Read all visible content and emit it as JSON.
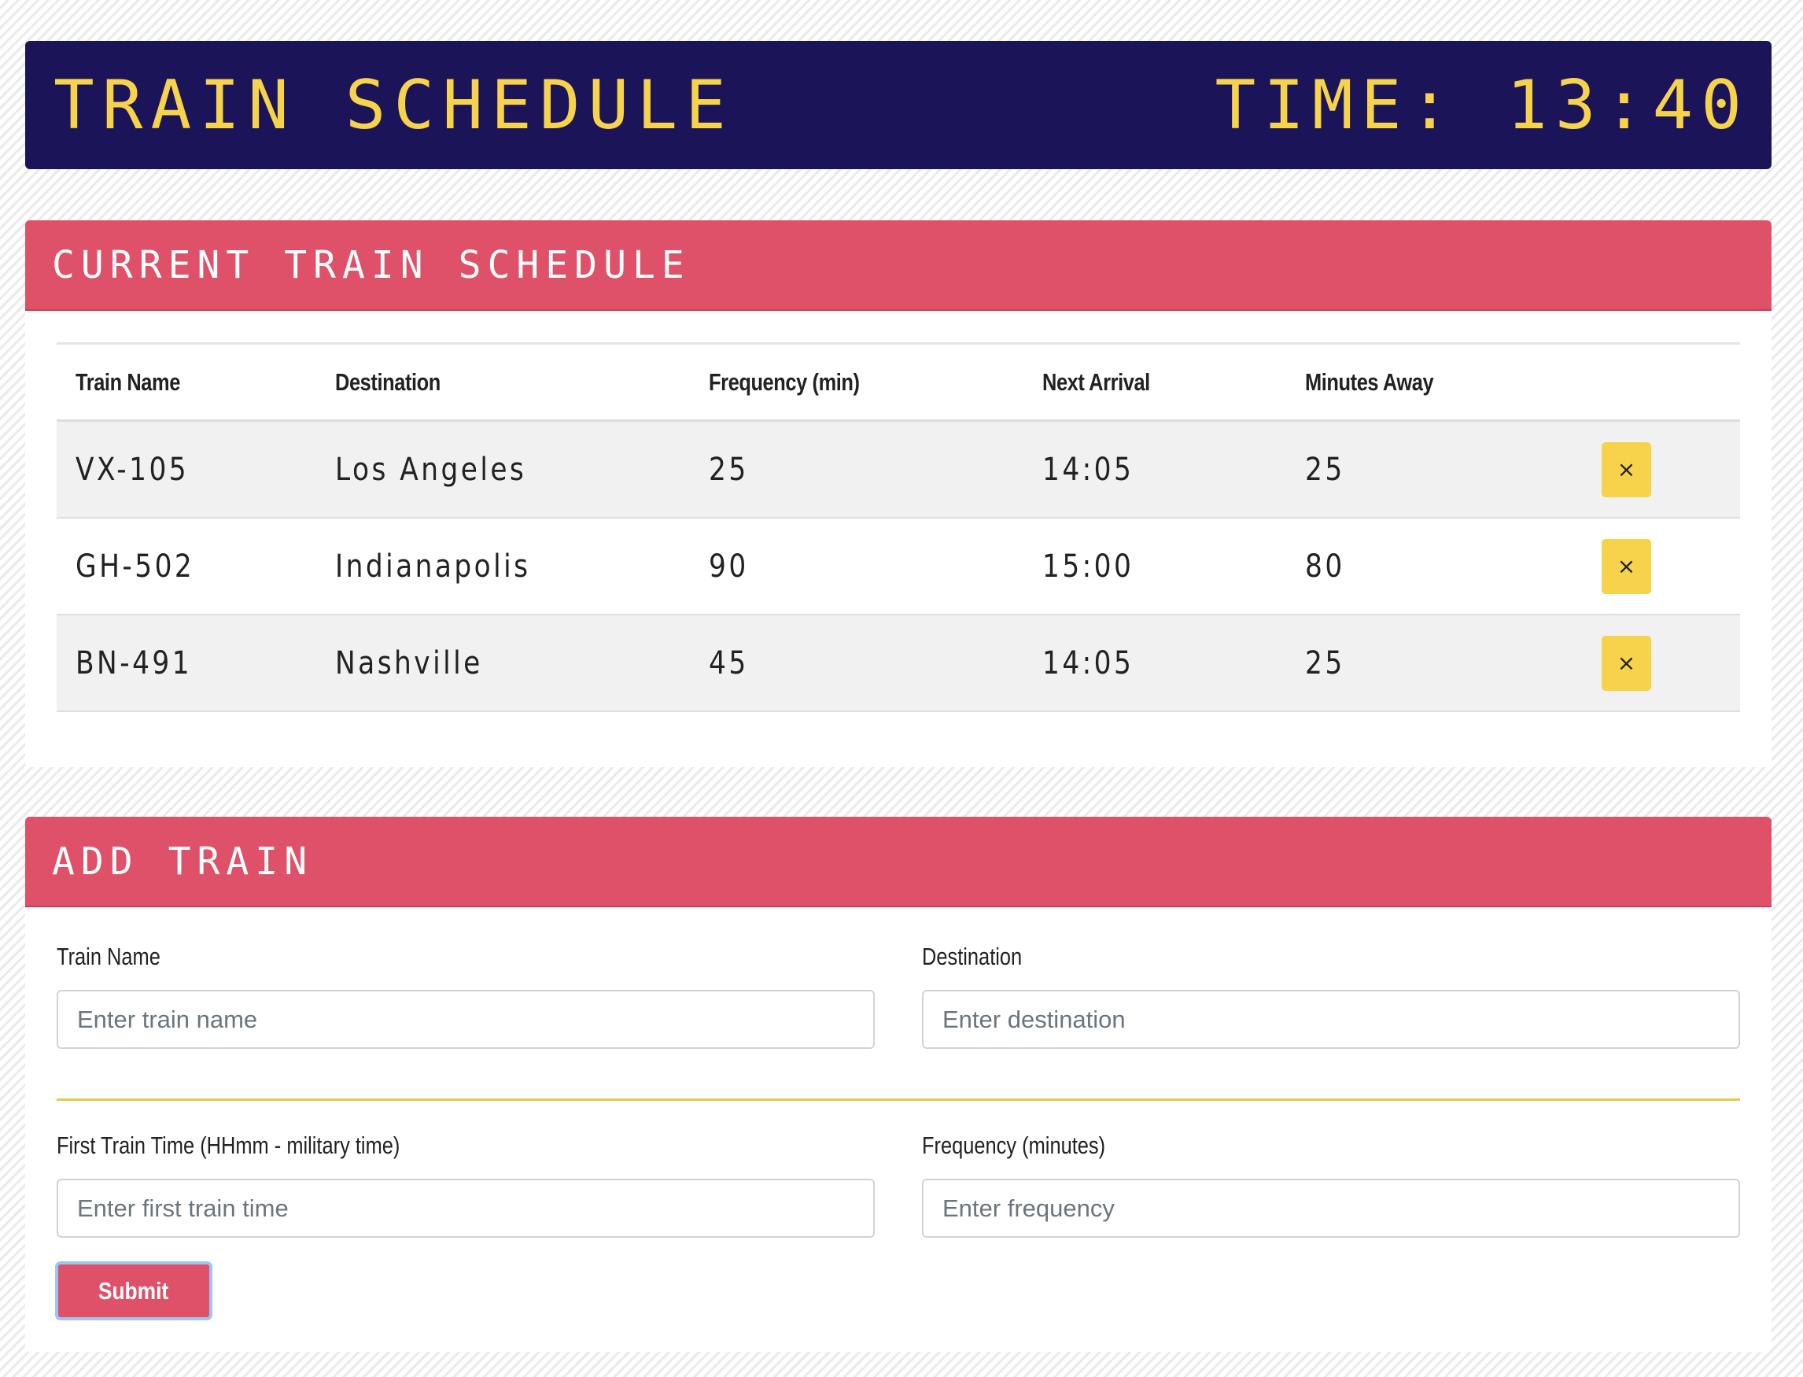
{
  "header": {
    "title": "Train Schedule",
    "time_label": "Time:",
    "time_value": "13:40"
  },
  "schedule": {
    "title": "Current Train Schedule",
    "columns": [
      "Train Name",
      "Destination",
      "Frequency (min)",
      "Next Arrival",
      "Minutes Away"
    ],
    "rows": [
      {
        "name": "VX-105",
        "destination": "Los Angeles",
        "frequency": "25",
        "next_arrival": "14:05",
        "minutes_away": "25",
        "delete_label": "×"
      },
      {
        "name": "GH-502",
        "destination": "Indianapolis",
        "frequency": "90",
        "next_arrival": "15:00",
        "minutes_away": "80",
        "delete_label": "×"
      },
      {
        "name": "BN-491",
        "destination": "Nashville",
        "frequency": "45",
        "next_arrival": "14:05",
        "minutes_away": "25",
        "delete_label": "×"
      }
    ]
  },
  "add_train": {
    "title": "Add Train",
    "train_name": {
      "label": "Train Name",
      "placeholder": "Enter train name",
      "value": ""
    },
    "destination": {
      "label": "Destination",
      "placeholder": "Enter destination",
      "value": ""
    },
    "first_time": {
      "label": "First Train Time (HHmm - military time)",
      "placeholder": "Enter first train time",
      "value": ""
    },
    "frequency": {
      "label": "Frequency (minutes)",
      "placeholder": "Enter frequency",
      "value": ""
    },
    "submit_label": "Submit"
  },
  "colors": {
    "header_bg": "#1b1458",
    "header_text": "#f6d34a",
    "panel_head_bg": "#df5169",
    "delete_button": "#f6d34a",
    "divider": "#e6c94a"
  },
  "icons": {
    "delete": "close-icon"
  }
}
